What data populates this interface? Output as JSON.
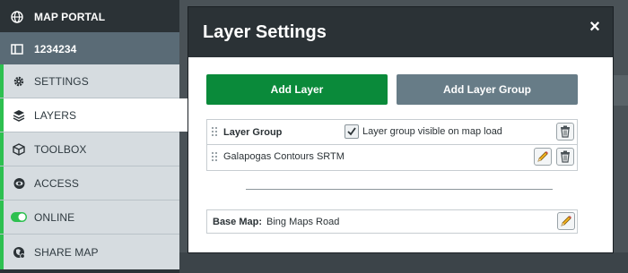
{
  "sidebar": {
    "items": [
      {
        "label": "MAP PORTAL",
        "icon": "globe-icon"
      },
      {
        "label": "1234234",
        "icon": "panel-icon"
      },
      {
        "label": "SETTINGS",
        "icon": "gear-icon"
      },
      {
        "label": "LAYERS",
        "icon": "layers-icon"
      },
      {
        "label": "TOOLBOX",
        "icon": "box-icon"
      },
      {
        "label": "ACCESS",
        "icon": "eye-icon"
      },
      {
        "label": "ONLINE",
        "icon": "toggle-icon"
      },
      {
        "label": "SHARE MAP",
        "icon": "share-globe-icon"
      }
    ],
    "accent_color": "#2ec050"
  },
  "modal": {
    "title": "Layer Settings",
    "close_label": "×",
    "add_layer_label": "Add Layer",
    "add_group_label": "Add Layer Group",
    "group": {
      "label": "Layer Group",
      "visible_checkbox_label": "Layer group visible on map load",
      "visible_checked": true
    },
    "layers": [
      {
        "label": "Galapogas Contours SRTM"
      }
    ],
    "basemap": {
      "key": "Base Map:",
      "value": "Bing Maps Road"
    },
    "colors": {
      "primary": "#0a8a3a",
      "secondary": "#677c87",
      "header": "#2b3236"
    }
  }
}
